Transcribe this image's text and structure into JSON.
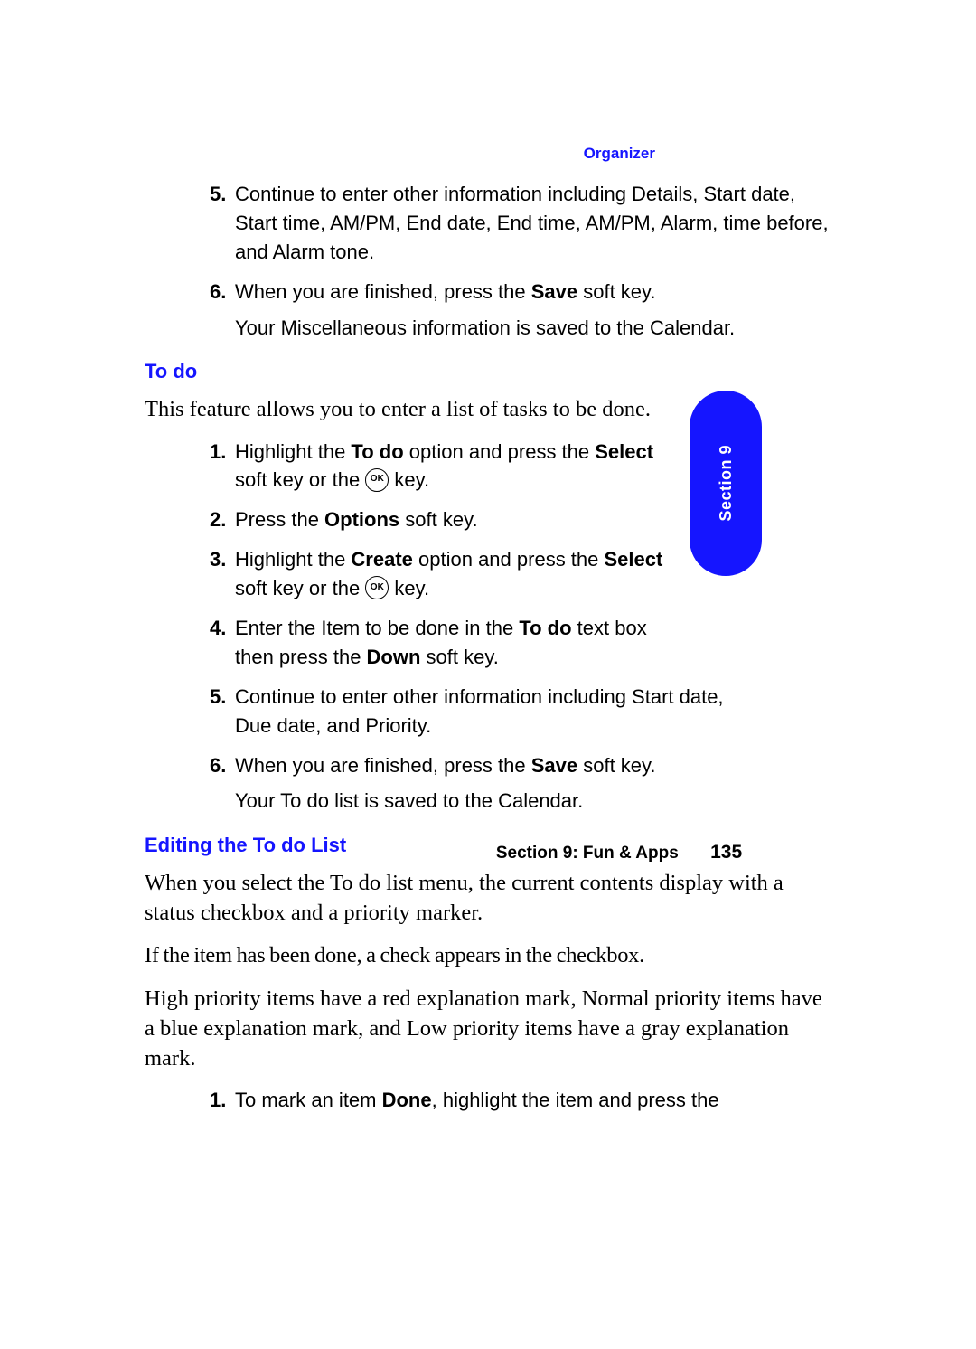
{
  "header": {
    "section_label": "Organizer"
  },
  "continuation_list": {
    "items": [
      {
        "num": "5.",
        "text": "Continue to enter other information including Details, Start date, Start time, AM/PM, End date, End time, AM/PM, Alarm, time before, and Alarm tone."
      },
      {
        "num": "6.",
        "text_parts": [
          "When you are finished, press the ",
          "Save",
          " soft key."
        ],
        "sub": "Your Miscellaneous information is saved to the Calendar."
      }
    ]
  },
  "todo": {
    "heading": "To do",
    "intro": "This feature allows you to enter a list of tasks to be done.",
    "items": [
      {
        "num": "1.",
        "segments": [
          "Highlight the ",
          "To do",
          " option and press the ",
          "Select",
          " soft key or the ",
          "OK",
          " key."
        ]
      },
      {
        "num": "2.",
        "segments": [
          "Press the ",
          "Options",
          " soft key."
        ]
      },
      {
        "num": "3.",
        "segments": [
          "Highlight the ",
          "Create",
          " option and press the ",
          "Select",
          " soft key or the ",
          "OK",
          " key."
        ]
      },
      {
        "num": "4.",
        "segments": [
          "Enter the Item to be done in the ",
          "To do",
          " text box then press the ",
          "Down",
          " soft key."
        ]
      },
      {
        "num": "5.",
        "text": "Continue to enter other information including Start date, Due date, and Priority."
      },
      {
        "num": "6.",
        "segments": [
          "When you are finished, press the ",
          "Save",
          " soft key."
        ],
        "sub": "Your To do list is saved to the Calendar."
      }
    ]
  },
  "editing": {
    "heading": "Editing the To do List",
    "para1": "When you select the To do list menu, the current contents display with a status checkbox and a priority marker.",
    "para2": "If the item has been done, a check appears in the checkbox.",
    "para3": "High priority items have a red explanation mark, Normal priority items have a blue explanation mark, and Low priority items have a gray explanation mark.",
    "items": [
      {
        "num": "1.",
        "segments": [
          "To mark an item ",
          "Done",
          ", highlight the item and press the"
        ]
      }
    ]
  },
  "sidetab": {
    "label": "Section 9"
  },
  "footer": {
    "section": "Section 9: Fun & Apps",
    "page": "135"
  }
}
